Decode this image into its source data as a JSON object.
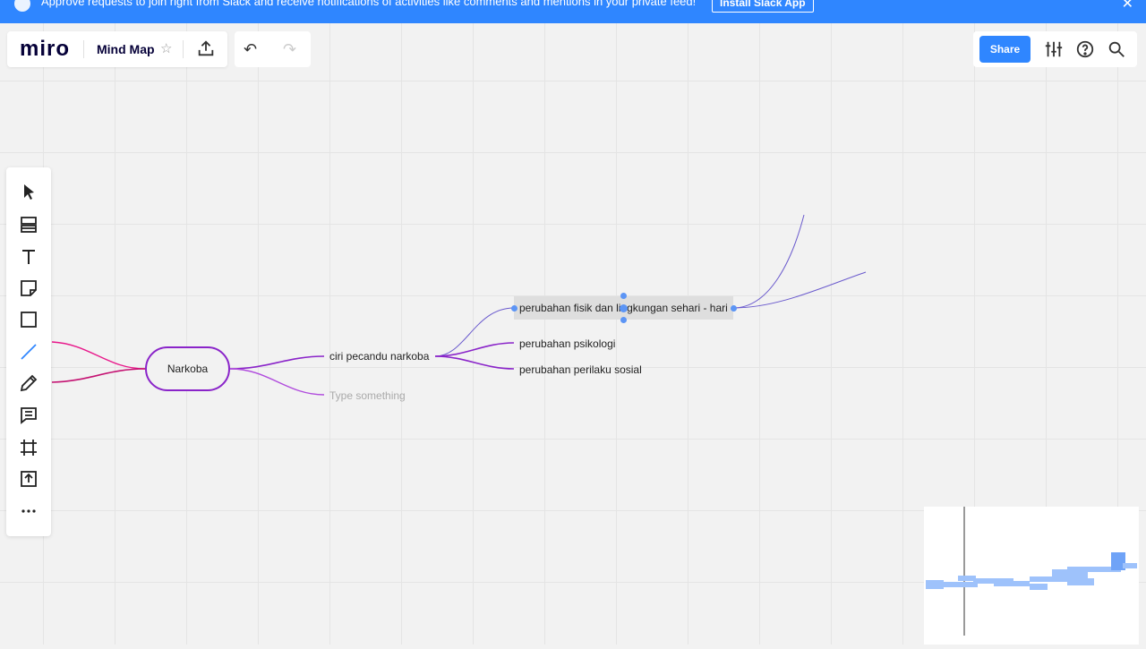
{
  "banner": {
    "message": "Approve requests to join right from Slack and receive notifications of activities like comments and mentions in your private feed!",
    "install_label": "Install Slack App",
    "close_icon": "close-icon"
  },
  "toolbar": {
    "logo": "miro",
    "board_title": "Mind Map",
    "star_icon": "star-icon",
    "export_icon": "upload-icon",
    "undo_icon": "undo-icon",
    "redo_icon": "redo-icon"
  },
  "right_toolbar": {
    "share_label": "Share",
    "icons": [
      "settings-sliders-icon",
      "help-icon",
      "search-icon"
    ]
  },
  "left_tools": [
    "cursor-icon",
    "templates-icon",
    "text-icon",
    "sticky-note-icon",
    "shape-icon",
    "line-icon",
    "pen-icon",
    "comment-icon",
    "frame-icon",
    "upload-icon",
    "more-icon"
  ],
  "mindmap": {
    "root": "Narkoba",
    "branch1": "ciri pecandu narkoba",
    "branch2_placeholder": "Type something",
    "child1": "perubahan fisik dan lingkungan sehari - hari",
    "child2": "perubahan psikologi",
    "child3": "perubahan perilaku sosial"
  },
  "colors": {
    "banner": "#2f86ff",
    "root_border": "#8a24c9",
    "branch_purple": "#8a24c9",
    "branch_pink": "#e8198b",
    "selection_handle": "#5c95f5"
  }
}
